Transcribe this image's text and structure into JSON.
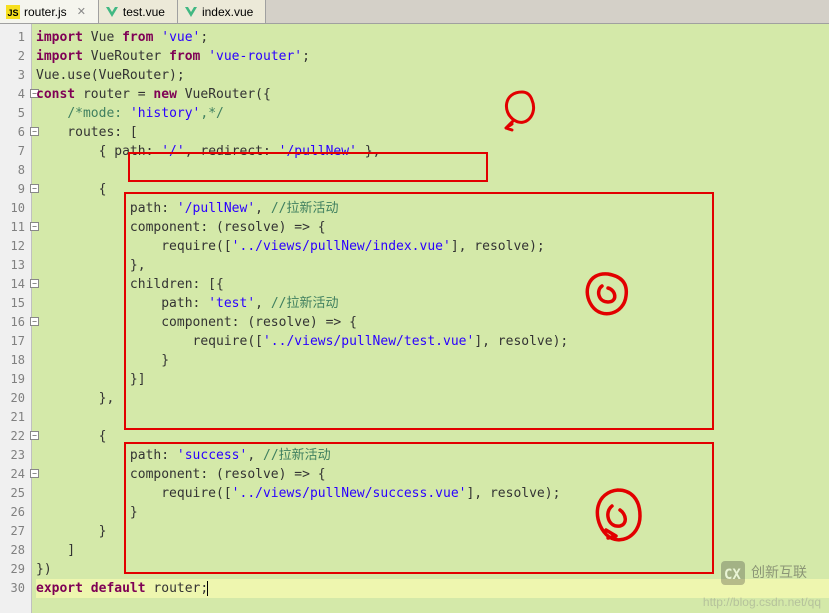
{
  "tabs": [
    {
      "label": "router.js",
      "icon": "js",
      "active": true,
      "hasClose": true
    },
    {
      "label": "test.vue",
      "icon": "vue",
      "active": false,
      "hasClose": false
    },
    {
      "label": "index.vue",
      "icon": "vue",
      "active": false,
      "hasClose": false
    }
  ],
  "lines": [
    "import Vue from 'vue';",
    "import VueRouter from 'vue-router';",
    "Vue.use(VueRouter);",
    "const router = new VueRouter({",
    "    /*mode: 'history',*/",
    "    routes: [",
    "        { path: '/', redirect: '/pullNew' },",
    "",
    "        {",
    "            path: '/pullNew', //拉新活动",
    "            component: (resolve) => {",
    "                require(['../views/pullNew/index.vue'], resolve);",
    "            },",
    "            children: [{",
    "                path: 'test', //拉新活动",
    "                component: (resolve) => {",
    "                    require(['../views/pullNew/test.vue'], resolve);",
    "                }",
    "            }]",
    "        },",
    "",
    "        {",
    "            path: 'success', //拉新活动",
    "            component: (resolve) => {",
    "                require(['../views/pullNew/success.vue'], resolve);",
    "            }",
    "        }",
    "    ]",
    "})",
    "export default router;"
  ],
  "foldLines": [
    4,
    6,
    9,
    11,
    14,
    16,
    22,
    24
  ],
  "currentLine": 30,
  "watermark_url": "http://blog.csdn.net/qq",
  "watermark_brand": "创新互联"
}
